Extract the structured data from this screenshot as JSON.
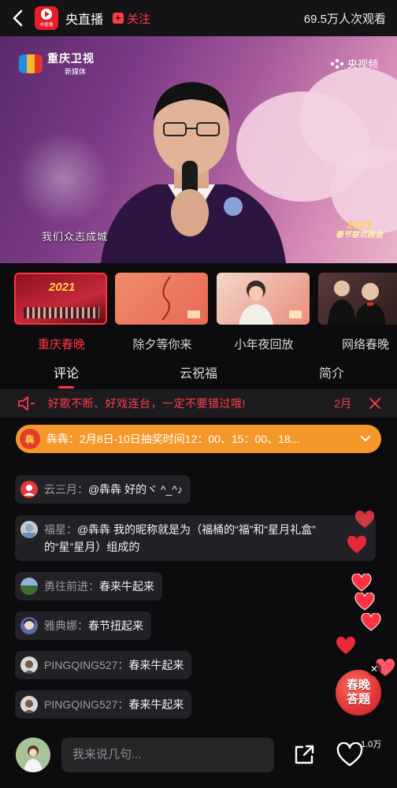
{
  "header": {
    "logo_text": "中直播",
    "channel": "央直播",
    "follow_label": "关注",
    "viewers": "69.5万人次观看"
  },
  "video": {
    "station_name": "重庆卫视",
    "station_sub": "新媒体",
    "watermark": "央视频",
    "subtitle": "我们众志成城",
    "badge_year": "2021",
    "badge_text": "春节联欢晚会"
  },
  "thumbnails": [
    {
      "label": "重庆春晚",
      "active": true
    },
    {
      "label": "除夕等你来",
      "active": false
    },
    {
      "label": "小年夜回放",
      "active": false
    },
    {
      "label": "网络春晚",
      "active": false
    }
  ],
  "tabs": [
    {
      "label": "评论",
      "active": true
    },
    {
      "label": "云祝福",
      "active": false
    },
    {
      "label": "简介",
      "active": false
    }
  ],
  "notice": {
    "text": "好歌不断、好戏连台，一定不要错过哦!",
    "month": "2月"
  },
  "banner": {
    "avatar_text": "犇",
    "text": "犇犇：2月8日-10日抽奖时间12：00、15：00、18..."
  },
  "comments": [
    {
      "name": "云三月：",
      "text": "@犇犇 好的ヾ ^_^♪",
      "avatar_color": "#e23a3a"
    },
    {
      "name": "福星：",
      "text_line1": "@犇犇 我的昵称就是为（福桶的“福”和“星月礼盒”",
      "text_line2": "的“星”星月）组成的",
      "avatar_color": "#c9c9c9"
    },
    {
      "name": "勇往前进：",
      "text": "春来牛起来",
      "avatar_color": "#4e7a45"
    },
    {
      "name": "雅典娜：",
      "text": "春节扭起来",
      "avatar_color": "#5d6aa8"
    },
    {
      "name": "PINGQING527：",
      "text": "春来牛起来",
      "avatar_color": "#d8d8d8"
    },
    {
      "name": "PINGQING527：",
      "text": "春来牛起来",
      "avatar_color": "#d8d8d8"
    }
  ],
  "quiz": {
    "line1": "春晚",
    "line2": "答题"
  },
  "bottom": {
    "input_placeholder": "我来说几句...",
    "like_count": "1.0万"
  },
  "colors": {
    "accent": "#ff3340",
    "banner": "#f5982a",
    "background": "#0c0c0e"
  }
}
